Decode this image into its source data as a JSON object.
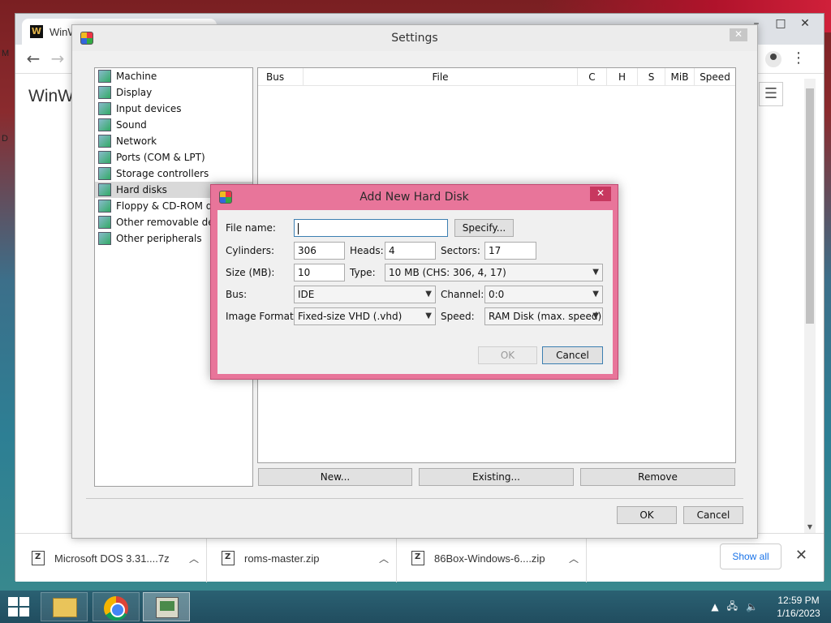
{
  "browser": {
    "tab_title": "WinW",
    "tab_favicon_letter": "W",
    "page_heading": "WinW",
    "window_controls": [
      "–",
      "□",
      "✕"
    ],
    "downloads": [
      {
        "name": "Microsoft DOS 3.31....7z"
      },
      {
        "name": "roms-master.zip"
      },
      {
        "name": "86Box-Windows-6....zip"
      }
    ],
    "show_all_label": "Show all"
  },
  "desktop": {
    "edge_letters": [
      "M",
      "D"
    ]
  },
  "settings": {
    "title": "Settings",
    "categories": [
      {
        "label": "Machine"
      },
      {
        "label": "Display"
      },
      {
        "label": "Input devices"
      },
      {
        "label": "Sound"
      },
      {
        "label": "Network"
      },
      {
        "label": "Ports (COM & LPT)"
      },
      {
        "label": "Storage controllers"
      },
      {
        "label": "Hard disks"
      },
      {
        "label": "Floppy & CD-ROM drives"
      },
      {
        "label": "Other removable devices"
      },
      {
        "label": "Other peripherals"
      }
    ],
    "selected_category": "Hard disks",
    "table_columns": [
      "Bus",
      "File",
      "C",
      "H",
      "S",
      "MiB",
      "Speed"
    ],
    "buttons": {
      "new": "New...",
      "existing": "Existing...",
      "remove": "Remove"
    },
    "ok_label": "OK",
    "cancel_label": "Cancel"
  },
  "add_disk": {
    "title": "Add New Hard Disk",
    "file_name_label": "File name:",
    "file_name_value": "",
    "specify_label": "Specify...",
    "cylinders_label": "Cylinders:",
    "cylinders_value": "306",
    "heads_label": "Heads:",
    "heads_value": "4",
    "sectors_label": "Sectors:",
    "sectors_value": "17",
    "size_label": "Size (MB):",
    "size_value": "10",
    "type_label": "Type:",
    "type_value": "10 MB (CHS: 306, 4, 17)",
    "bus_label": "Bus:",
    "bus_value": "IDE",
    "channel_label": "Channel:",
    "channel_value": "0:0",
    "image_format_label": "Image Format:",
    "image_format_value": "Fixed-size VHD (.vhd)",
    "speed_label": "Speed:",
    "speed_value": "RAM Disk (max. speed)",
    "ok_label": "OK",
    "cancel_label": "Cancel"
  },
  "taskbar": {
    "time": "12:59 PM",
    "date": "1/16/2023"
  }
}
